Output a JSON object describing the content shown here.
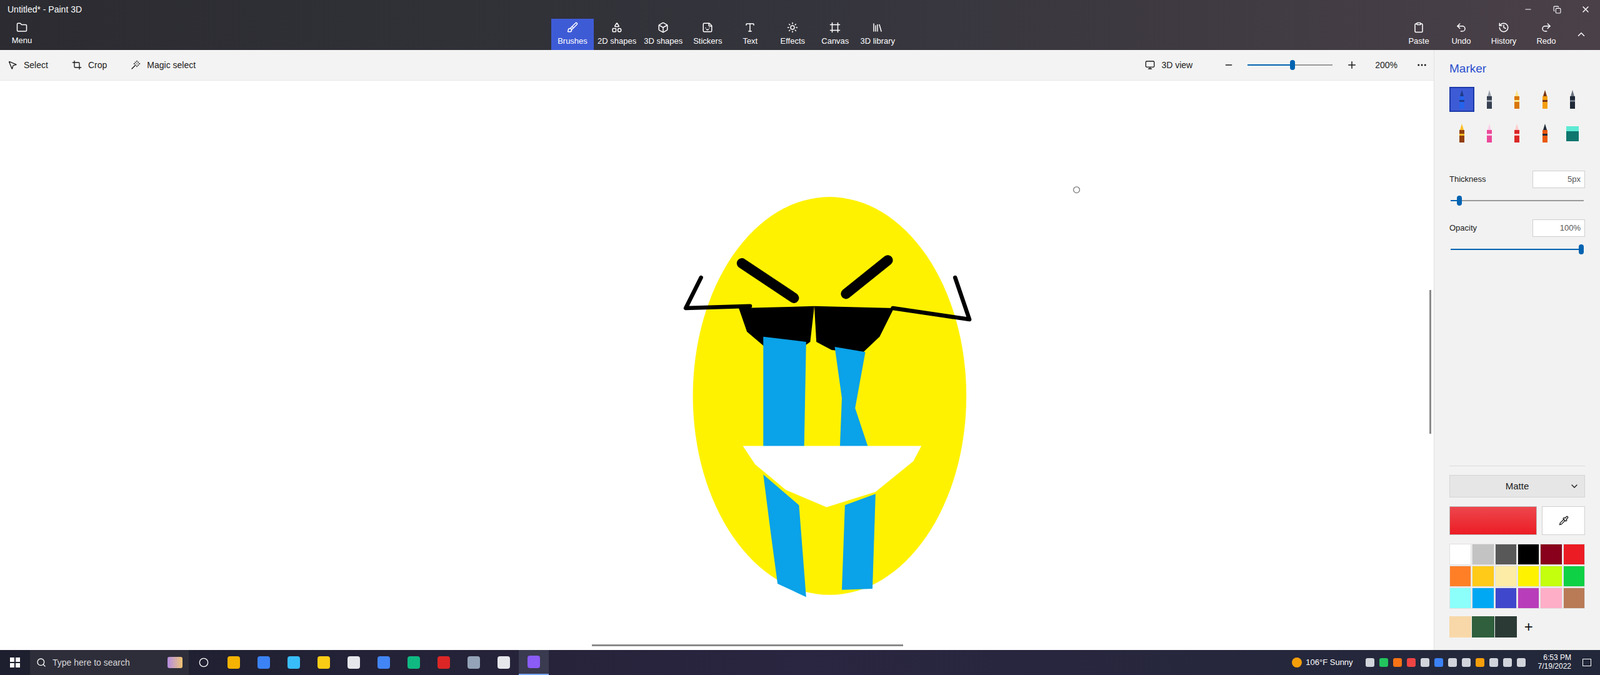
{
  "window": {
    "title": "Untitled* - Paint 3D",
    "menu": "Menu"
  },
  "tools": [
    {
      "label": "Brushes",
      "selected": true
    },
    {
      "label": "2D shapes",
      "selected": false
    },
    {
      "label": "3D shapes",
      "selected": false
    },
    {
      "label": "Stickers",
      "selected": false
    },
    {
      "label": "Text",
      "selected": false
    },
    {
      "label": "Effects",
      "selected": false
    },
    {
      "label": "Canvas",
      "selected": false
    },
    {
      "label": "3D library",
      "selected": false
    }
  ],
  "actions": [
    "Paste",
    "Undo",
    "History",
    "Redo"
  ],
  "subtoolbar": {
    "tools": [
      "Select",
      "Crop",
      "Magic select"
    ],
    "view": "3D view",
    "zoom": {
      "reading": "200%",
      "level": 0.53
    }
  },
  "panel": {
    "title": "Marker",
    "brushes": [
      {
        "kind": "marker",
        "selected": true
      },
      {
        "kind": "calligraphy",
        "selected": false
      },
      {
        "kind": "oil",
        "selected": false
      },
      {
        "kind": "watercolor",
        "selected": false
      },
      {
        "kind": "pixel",
        "selected": false
      },
      {
        "kind": "pencil",
        "selected": false
      },
      {
        "kind": "eraser",
        "selected": false
      },
      {
        "kind": "crayon",
        "selected": false
      },
      {
        "kind": "spray",
        "selected": false
      },
      {
        "kind": "fill",
        "selected": false
      }
    ],
    "thickness": {
      "label": "Thickness",
      "reading": "5px",
      "level": 0.05
    },
    "opacity": {
      "label": "Opacity",
      "reading": "100%",
      "level": 1
    },
    "material": "Matte",
    "current_color": "#ec1c24",
    "palette": [
      {
        "color": "#ffffff"
      },
      {
        "color": "#c3c3c3"
      },
      {
        "color": "#585858"
      },
      {
        "color": "#000000"
      },
      {
        "color": "#88001b"
      },
      {
        "color": "#ec1c24"
      },
      {
        "color": "#ff7f27"
      },
      {
        "color": "#ffca18"
      },
      {
        "color": "#fdeca6"
      },
      {
        "color": "#fff200"
      },
      {
        "color": "#c4ff0e"
      },
      {
        "color": "#0ed145"
      },
      {
        "color": "#8cfffb"
      },
      {
        "color": "#00a8f3"
      },
      {
        "color": "#3f48cc"
      },
      {
        "color": "#b83dba"
      },
      {
        "color": "#ffaec8"
      },
      {
        "color": "#b97a56"
      }
    ],
    "custom_colors": [
      {
        "color": "#f8d8a8"
      },
      {
        "color": "#2f5f3c"
      },
      {
        "color": "#2b3a35"
      }
    ],
    "add": "+"
  },
  "taskbar": {
    "search_placeholder": "Type here to search",
    "weather": "106°F Sunny",
    "time": "6:53 PM",
    "date": "7/19/2022"
  }
}
